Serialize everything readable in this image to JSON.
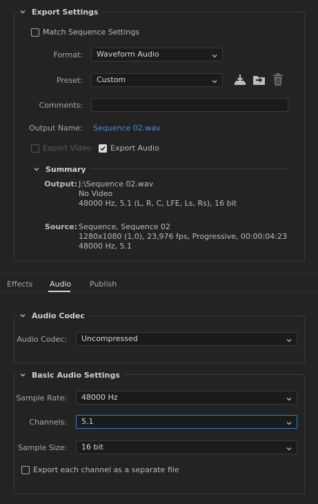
{
  "export_settings": {
    "title": "Export Settings",
    "match_sequence_label": "Match Sequence Settings",
    "format_label": "Format:",
    "format_value": "Waveform Audio",
    "preset_label": "Preset:",
    "preset_value": "Custom",
    "comments_label": "Comments:",
    "comments_value": "",
    "output_name_label": "Output Name:",
    "output_name_value": "Sequence 02.wav",
    "export_video_label": "Export Video",
    "export_audio_label": "Export Audio",
    "icons": [
      "save-preset-icon",
      "import-preset-icon",
      "delete-preset-icon"
    ]
  },
  "summary": {
    "title": "Summary",
    "output_key": "Output:",
    "output_lines": [
      "J:\\Sequence 02.wav",
      "No Video",
      "48000 Hz, 5.1 (L, R, C, LFE, Ls, Rs), 16 bit"
    ],
    "source_key": "Source:",
    "source_lines": [
      "Sequence, Sequence 02",
      "1280x1080 (1,0), 23,976 fps, Progressive, 00:00:04:23",
      "48000 Hz, 5.1"
    ]
  },
  "tabs": [
    {
      "label": "Effects",
      "active": false
    },
    {
      "label": "Audio",
      "active": true
    },
    {
      "label": "Publish",
      "active": false
    }
  ],
  "audio_codec": {
    "title": "Audio Codec",
    "codec_label": "Audio Codec:",
    "codec_value": "Uncompressed"
  },
  "basic_audio": {
    "title": "Basic Audio Settings",
    "sample_rate_label": "Sample Rate:",
    "sample_rate_value": "48000 Hz",
    "channels_label": "Channels:",
    "channels_value": "5.1",
    "sample_size_label": "Sample Size:",
    "sample_size_value": "16 bit",
    "separate_file_label": "Export each channel as a separate file"
  },
  "colors": {
    "background": "#232323",
    "field": "#1b1b1b",
    "link": "#4f8ed8",
    "focus": "#3d7bd1",
    "tab_underline": "#d8d8d8"
  }
}
